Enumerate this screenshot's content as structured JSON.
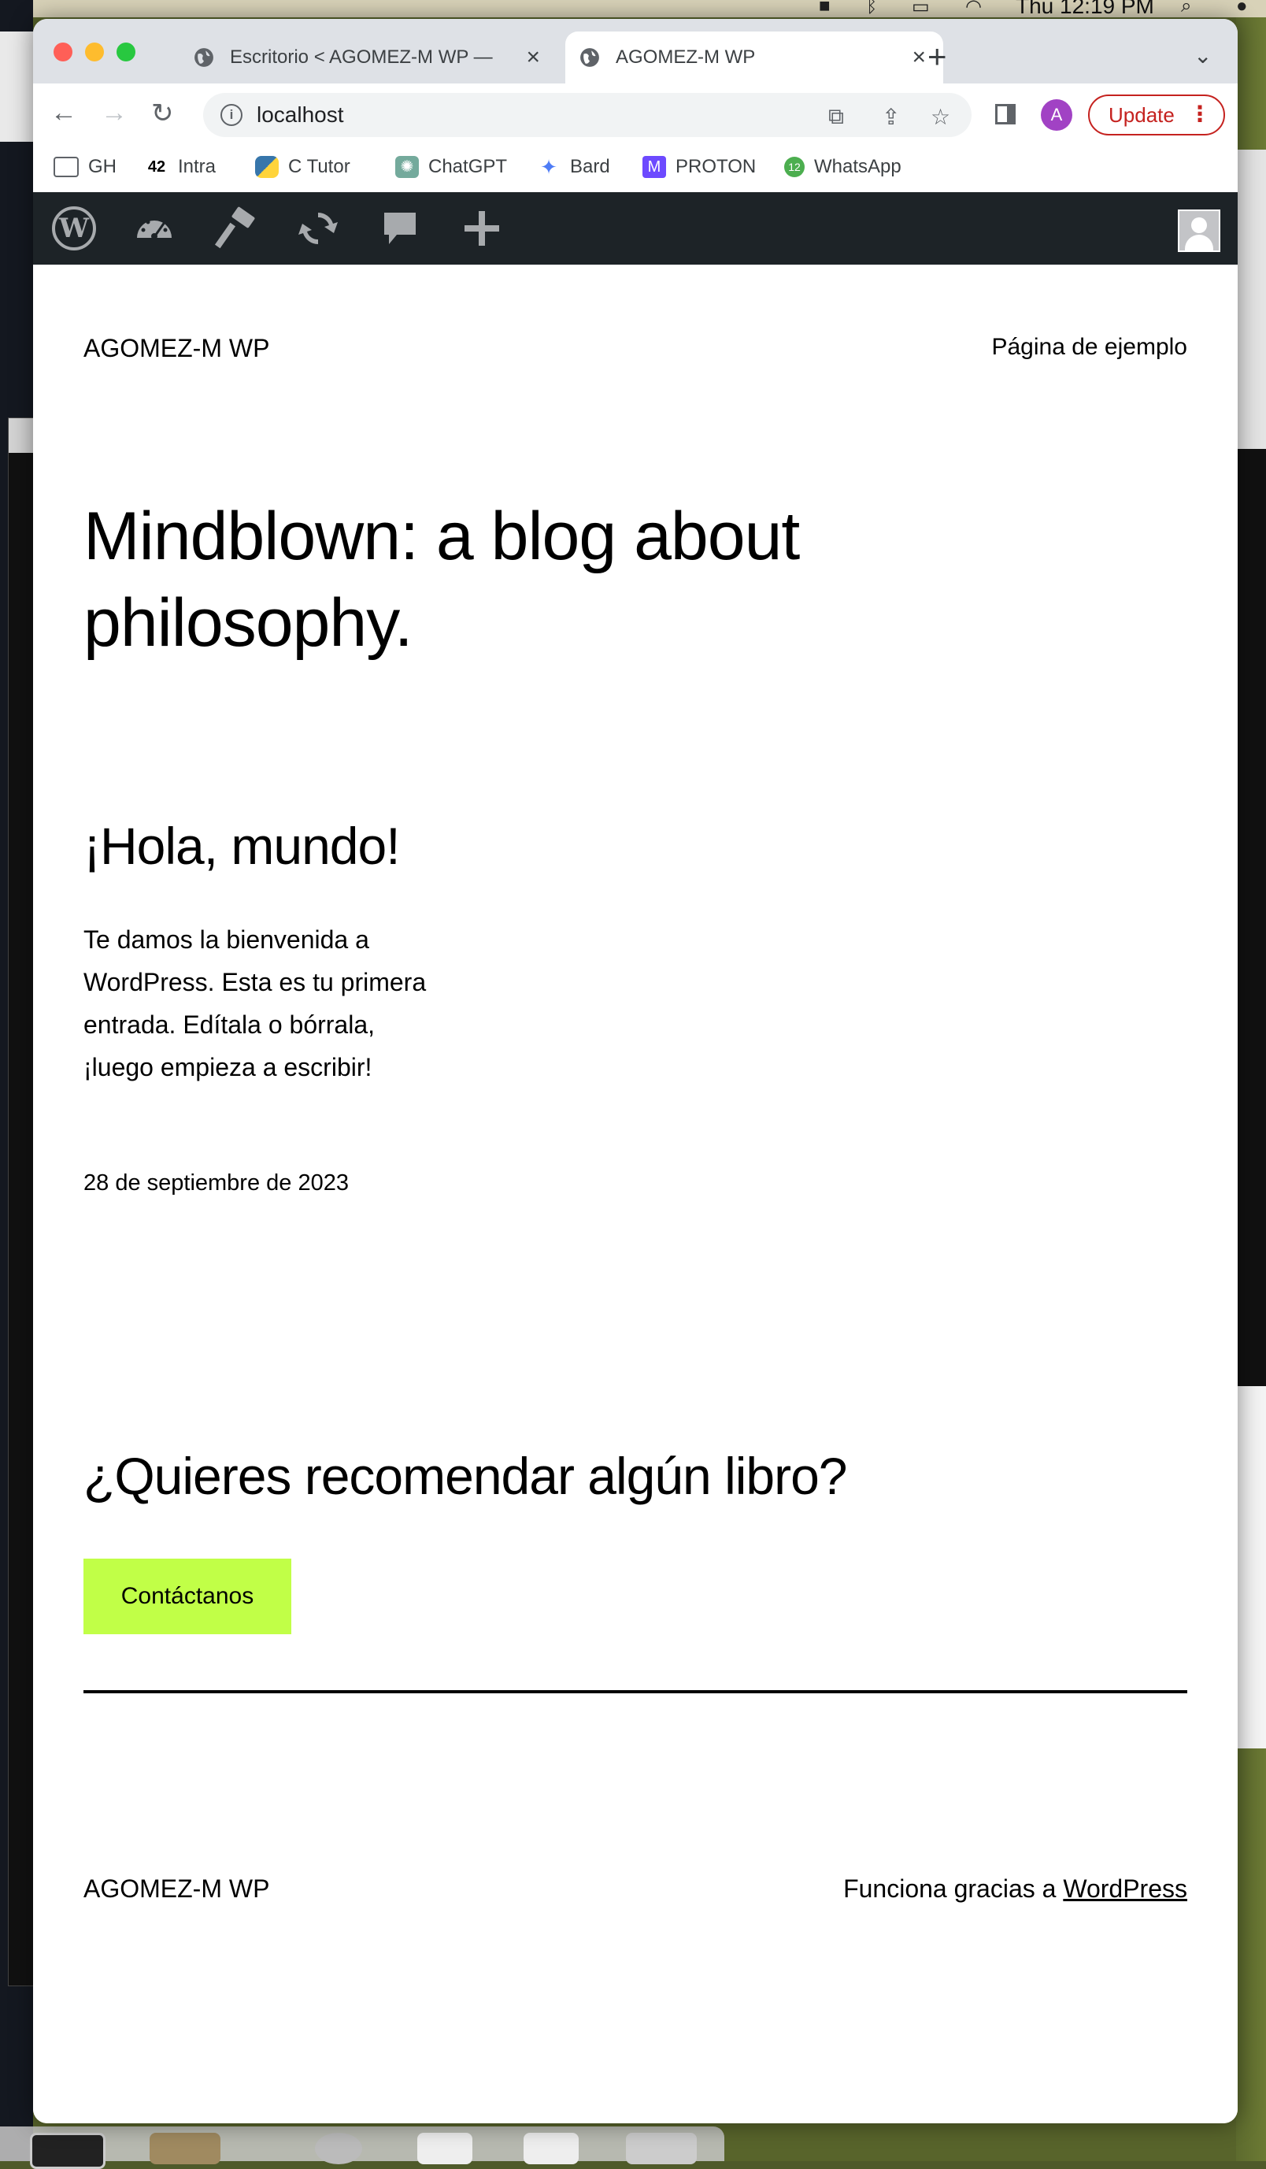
{
  "menubar": {
    "clock": "Thu 12:19 PM"
  },
  "browser": {
    "tabs": [
      {
        "title": "Escritorio < AGOMEZ-M WP —",
        "active": false
      },
      {
        "title": "AGOMEZ-M WP",
        "active": true
      }
    ],
    "url": "localhost",
    "profile_initial": "A",
    "update_label": "Update",
    "bookmarks": [
      {
        "label": "GH",
        "icon": "folder-icon"
      },
      {
        "label": "Intra",
        "icon": "42-logo-icon"
      },
      {
        "label": "C Tutor",
        "icon": "python-icon"
      },
      {
        "label": "ChatGPT",
        "icon": "chatgpt-icon"
      },
      {
        "label": "Bard",
        "icon": "bard-icon"
      },
      {
        "label": "PROTON",
        "icon": "proton-icon"
      },
      {
        "label": "WhatsApp",
        "icon": "whatsapp-icon",
        "badge": "12"
      }
    ]
  },
  "admin_bar": {
    "icons": [
      "wordpress-logo-icon",
      "dashboard-icon",
      "customize-icon",
      "updates-icon",
      "comments-icon",
      "new-content-icon",
      "user-avatar-icon"
    ]
  },
  "site": {
    "title": "AGOMEZ-M WP",
    "nav_link": "Página de ejemplo",
    "hero": "Mindblown: a blog about philosophy.",
    "post": {
      "title": "¡Hola, mundo!",
      "excerpt": "Te damos la bienvenida a WordPress. Esta es tu primera entrada. Edítala o bórrala, ¡luego empieza a escribir!",
      "date": "28 de septiembre de 2023"
    },
    "cta": {
      "title": "¿Quieres recomendar algún libro?",
      "button": "Contáctanos",
      "button_color": "#c1ff47"
    },
    "footer": {
      "title": "AGOMEZ-M WP",
      "credit_prefix": "Funciona gracias a ",
      "credit_link": "WordPress"
    }
  }
}
